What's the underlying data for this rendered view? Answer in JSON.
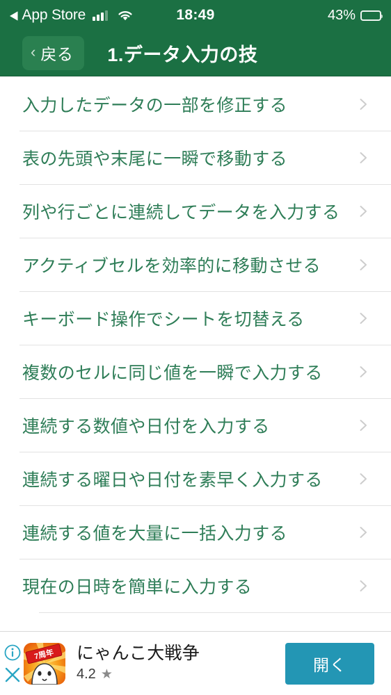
{
  "status_bar": {
    "carrier_back_label": "App Store",
    "back_triangle": "◀",
    "time": "18:49",
    "battery_percent": "43%",
    "battery_level": 43,
    "signal_icon": "signal-bars-icon",
    "wifi_icon": "wifi-icon"
  },
  "nav": {
    "back_label": "戻る",
    "back_chevron": "‹",
    "title": "1.データ入力の技"
  },
  "theme": {
    "header_green": "#1B7043",
    "item_text_green": "#2E7D57",
    "cta_teal": "#2396B4",
    "divider_gray": "#e2e2e2"
  },
  "list": {
    "items": [
      {
        "label": "入力したデータの一部を修正する"
      },
      {
        "label": "表の先頭や末尾に一瞬で移動する"
      },
      {
        "label": "列や行ごとに連続してデータを入力する"
      },
      {
        "label": "アクティブセルを効率的に移動させる"
      },
      {
        "label": "キーボード操作でシートを切替える"
      },
      {
        "label": "複数のセルに同じ値を一瞬で入力する"
      },
      {
        "label": "連続する数値や日付を入力する"
      },
      {
        "label": "連続する曜日や日付を素早く入力する"
      },
      {
        "label": "連続する値を大量に一括入力する"
      },
      {
        "label": "現在の日時を簡単に入力する"
      }
    ]
  },
  "ad": {
    "app_title": "にゃんこ大戦争",
    "rating": "4.2",
    "star_glyph": "★",
    "cta_label": "開く",
    "icon_badge_text": "7周年",
    "info_icon": "info-icon",
    "close_icon": "close-icon"
  }
}
